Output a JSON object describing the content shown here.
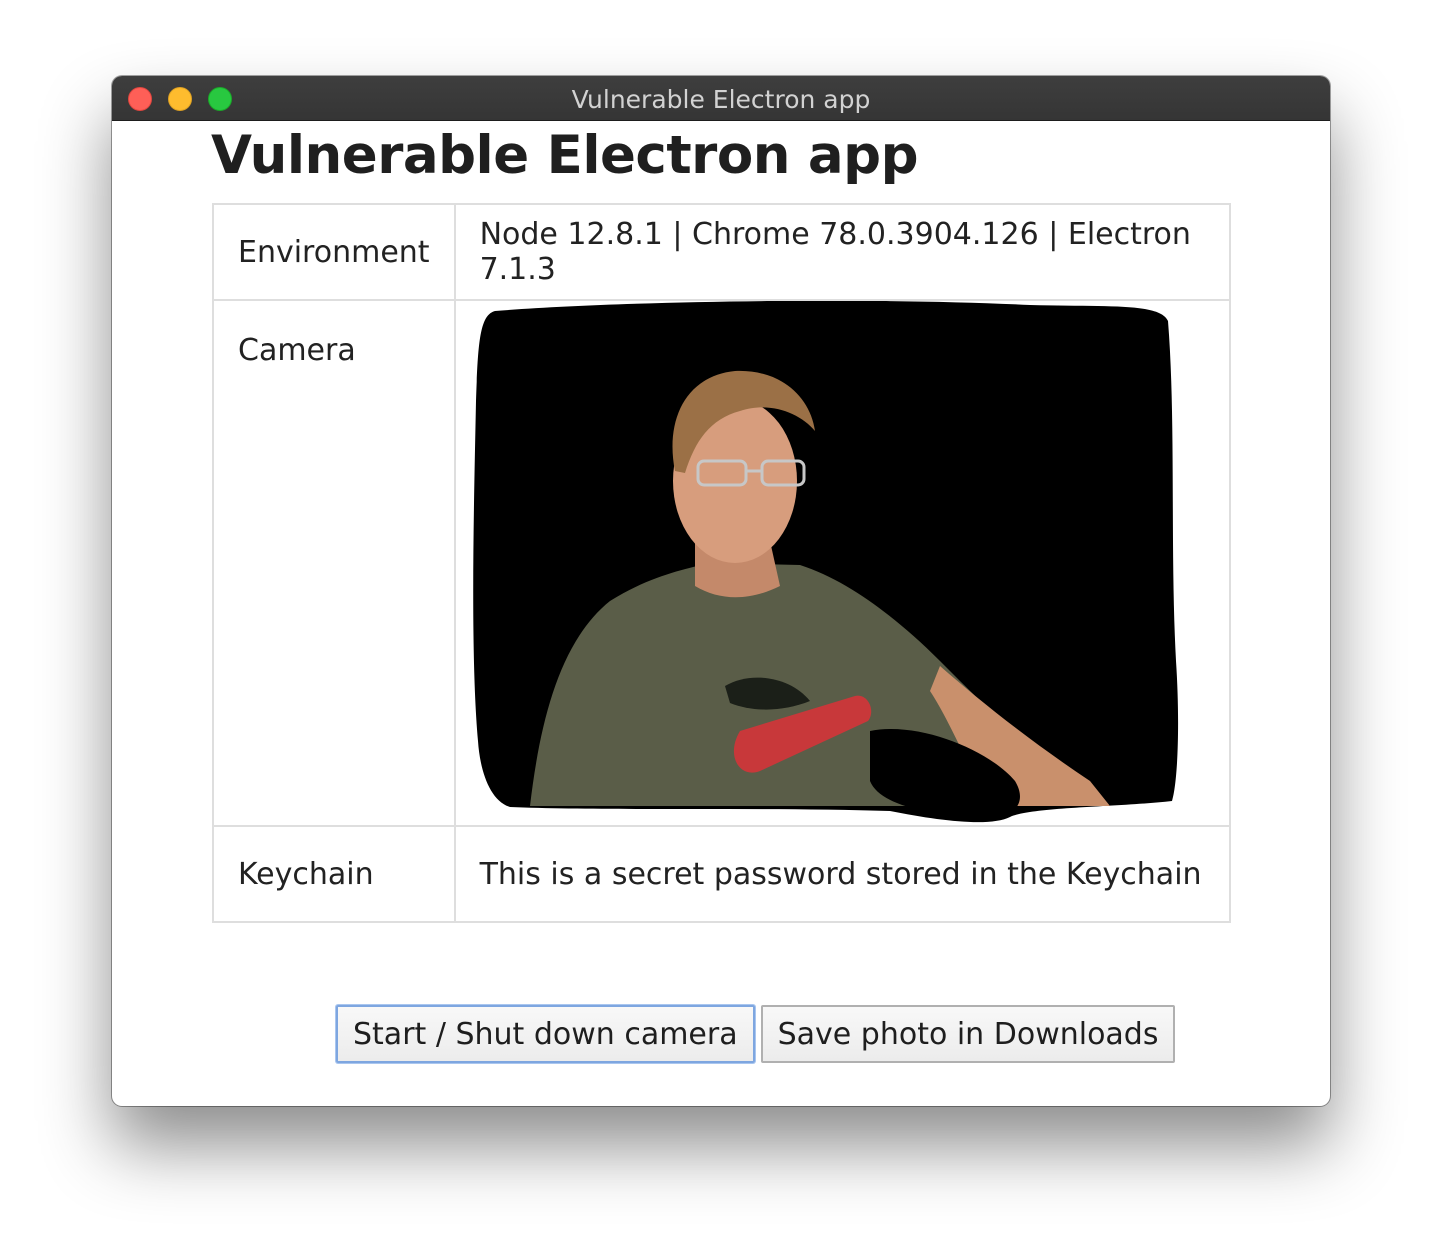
{
  "window": {
    "title": "Vulnerable Electron app"
  },
  "page": {
    "heading": "Vulnerable Electron app"
  },
  "table": {
    "rows": [
      {
        "key": "Environment",
        "value": "Node 12.8.1 | Chrome 78.0.3904.126 | Electron 7.1.3"
      },
      {
        "key": "Camera",
        "value": ""
      },
      {
        "key": "Keychain",
        "value": "This is a secret password stored in the Keychain"
      }
    ]
  },
  "buttons": {
    "camera_toggle": "Start / Shut down camera",
    "save_photo": "Save photo in Downloads"
  },
  "colors": {
    "close": "#fe5f57",
    "minimize": "#febc2e",
    "zoom": "#28c840",
    "focus_ring": "#7ea6e0"
  },
  "icons": [
    "close-icon",
    "minimize-icon",
    "zoom-icon"
  ]
}
